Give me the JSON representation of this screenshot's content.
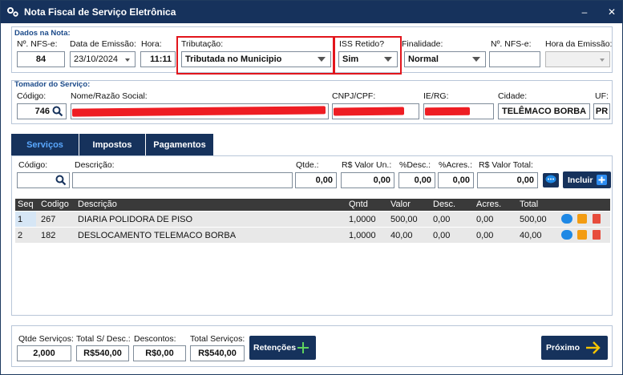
{
  "window": {
    "title": "Nota Fiscal de Serviço Eletrônica",
    "minimize_label": "–",
    "close_label": "✕"
  },
  "dados_nota": {
    "group_title": "Dados na Nota:",
    "nfse_label": "Nº. NFS-e:",
    "nfse_value": "84",
    "data_emissao_label": "Data de Emissão:",
    "data_emissao_value": "23/10/2024",
    "hora_label": "Hora:",
    "hora_value": "11:11",
    "tributacao_label": "Tributação:",
    "tributacao_value": "Tributada no Municipio",
    "iss_retido_label": "ISS Retido?",
    "iss_retido_value": "Sim",
    "finalidade_label": "Finalidade:",
    "finalidade_value": "Normal",
    "nfse_ref_label": "Nº. NFS-e:",
    "nfse_ref_value": "",
    "hora_emissao_label": "Hora da Emissão:",
    "hora_emissao_value": ""
  },
  "tomador": {
    "group_title": "Tomador do Serviço:",
    "codigo_label": "Código:",
    "codigo_value": "746",
    "nome_label": "Nome/Razão Social:",
    "cnpj_label": "CNPJ/CPF:",
    "ie_label": "IE/RG:",
    "cidade_label": "Cidade:",
    "cidade_value": "TELÊMACO BORBA",
    "uf_label": "UF:",
    "uf_value": "PR"
  },
  "tabs": [
    {
      "label": "Serviços"
    },
    {
      "label": "Impostos"
    },
    {
      "label": "Pagamentos"
    }
  ],
  "servico_entry": {
    "codigo_label": "Código:",
    "descricao_label": "Descrição:",
    "qtde_label": "Qtde.:",
    "qtde_value": "0,00",
    "valor_un_label": "R$ Valor Un.:",
    "valor_un_value": "0,00",
    "desc_label": "%Desc.:",
    "desc_value": "0,00",
    "acres_label": "%Acres.:",
    "acres_value": "0,00",
    "valor_total_label": "R$ Valor Total:",
    "valor_total_value": "0,00",
    "incluir_label": "Incluir"
  },
  "grid": {
    "columns": [
      "Seq",
      "Codigo",
      "Descrição",
      "Qntd",
      "Valor",
      "Desc.",
      "Acres.",
      "Total"
    ],
    "rows": [
      {
        "seq": "1",
        "codigo": "267",
        "descricao": "DIARIA POLIDORA DE PISO",
        "qntd": "1,0000",
        "valor": "500,00",
        "desc": "0,00",
        "acres": "0,00",
        "total": "500,00"
      },
      {
        "seq": "2",
        "codigo": "182",
        "descricao": "DESLOCAMENTO  TELEMACO BORBA",
        "qntd": "1,0000",
        "valor": "40,00",
        "desc": "0,00",
        "acres": "0,00",
        "total": "40,00"
      }
    ]
  },
  "totals": {
    "qtde_servicos_label": "Qtde Serviços:",
    "qtde_servicos_value": "2,000",
    "total_sem_desc_label": "Total S/ Desc.:",
    "total_sem_desc_value": "R$540,00",
    "descontos_label": "Descontos:",
    "descontos_value": "R$0,00",
    "total_servicos_label": "Total Serviços:",
    "total_servicos_value": "R$540,00",
    "retencoes_label": "Retenções",
    "proximo_label": "Próximo"
  },
  "colors": {
    "accent": "#16325c",
    "highlight": "#e2151c",
    "tab_active": "#5aa8ff"
  },
  "icons": [
    "settings-icon",
    "search-icon",
    "comment-icon",
    "edit-icon",
    "trash-icon",
    "plus-icon",
    "arrow-right-icon"
  ]
}
